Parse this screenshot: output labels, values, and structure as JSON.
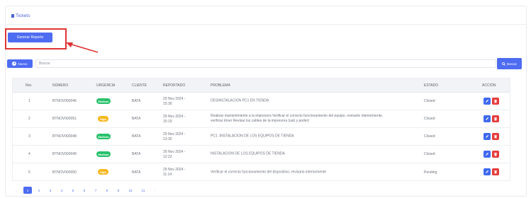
{
  "header": {
    "title": "Tickets"
  },
  "toolbar": {
    "report_label": "Generar Reporte",
    "new_label": "Nuevo",
    "search_placeholder": "Buscar",
    "search_label": "Buscar"
  },
  "table": {
    "columns": [
      "Nro.",
      "NÚMERO",
      "URGENCIA",
      "CLIENTE",
      "REPORTADO",
      "PROBLEMA",
      "ESTADO",
      "ACCIÓN"
    ],
    "rows": [
      {
        "nro": "1",
        "numero": "BTNOV000046",
        "urgencia": "Medium",
        "cliente": "BATA",
        "reportado": "29 Nov 2024 - 15:30",
        "problema": "DESINSTALACION PC1 EN TIENDA",
        "estado": "Closed"
      },
      {
        "nro": "2",
        "numero": "BTNOV000051",
        "urgencia": "High",
        "cliente": "BATA",
        "reportado": "29 Nov 2024 - 15:19",
        "problema": "Realizar mantenimiento a la impresora Verificar el correcto funcionamiento del equipo, revisarlo interiormente, verificar tóner Revisar los cables de la impresora (usb y poder)",
        "estado": "Closed"
      },
      {
        "nro": "3",
        "numero": "BTNOV000048",
        "urgencia": "Medium",
        "cliente": "BATA",
        "reportado": "29 Nov 2024 - 13:30",
        "problema": "PC1 -INSTALACION DE LOS EQUIPOS DE TIENDA",
        "estado": "Closed"
      },
      {
        "nro": "4",
        "numero": "BTNOV000049",
        "urgencia": "Medium",
        "cliente": "BATA",
        "reportado": "29 Nov 2024 - 12:22",
        "problema": "INSTALACION DE LOS EQUIPOS DE TIENDA",
        "estado": "Closed"
      },
      {
        "nro": "5",
        "numero": "BTNOV000050",
        "urgencia": "High",
        "cliente": "BATA",
        "reportado": "29 Nov 2024 - 11:14",
        "problema": "Verificar el correcto funcionamiento del dispositivo, revisarlo interiormente",
        "estado": "Pending"
      }
    ]
  },
  "pagination": {
    "prev": "‹",
    "pages": [
      "1",
      "2",
      "3",
      "4",
      "5",
      "6",
      "7",
      "8",
      "9",
      "10",
      "11"
    ],
    "next": "›",
    "active": "1"
  },
  "colors": {
    "primary": "#4e6cf2",
    "medium": "#27c16b",
    "high": "#f5b81f",
    "danger": "#e63b3b",
    "annotation": "#e03434"
  }
}
